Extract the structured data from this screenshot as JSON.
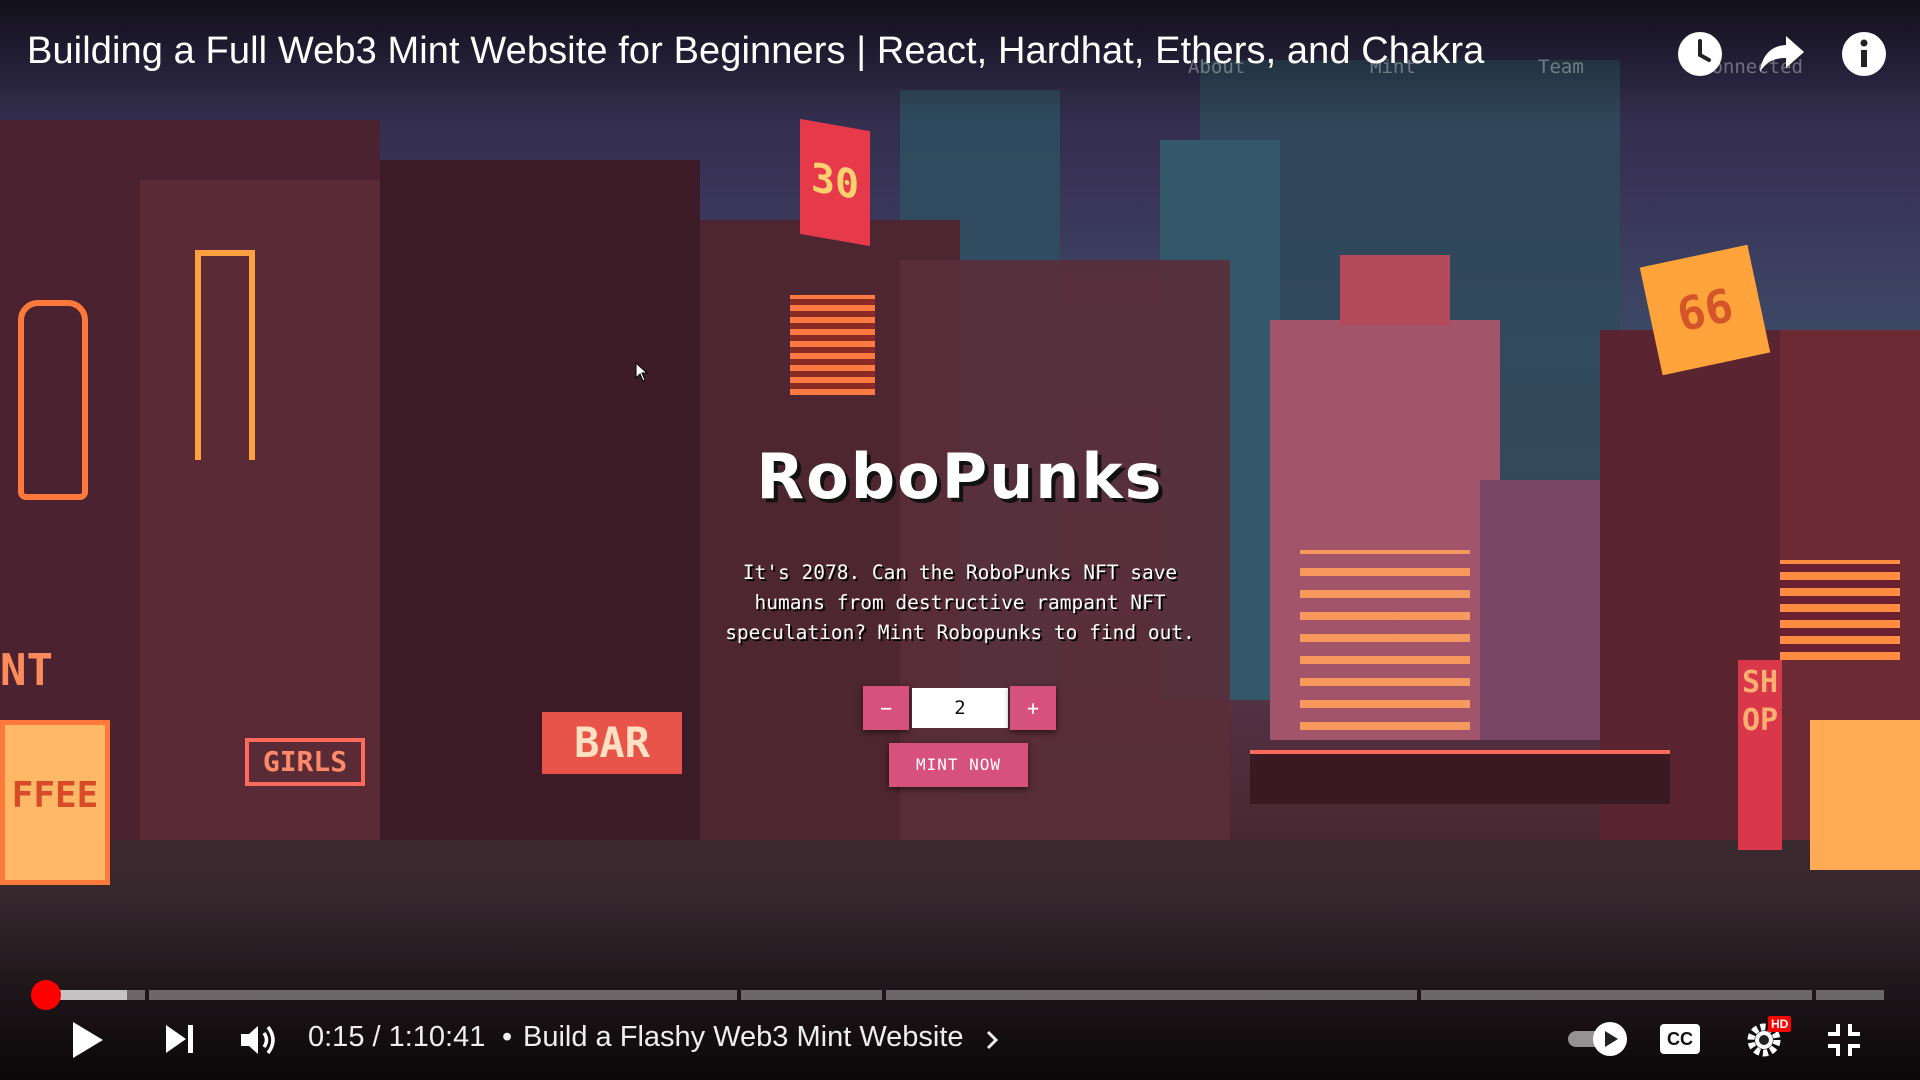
{
  "video": {
    "title": "Building a Full Web3 Mint Website for Beginners | React, Hardhat, Ethers, and Chakra"
  },
  "site": {
    "nav": [
      "About",
      "Mint",
      "Team",
      "Connected"
    ],
    "title": "RoboPunks",
    "description": "It's 2078. Can the RoboPunks NFT save humans from destructive rampant NFT speculation? Mint Robopunks to find out.",
    "quantity": "2",
    "decrement_label": "−",
    "increment_label": "+",
    "mint_label": "MINT NOW",
    "accent_color": "#d6517d"
  },
  "player": {
    "time": "0:15 / 1:10:41",
    "separator": "•",
    "chapter": "Build a Flashy Web3 Mint Website",
    "progress_fraction": 0.0035,
    "buffered_fraction": 0.047,
    "quality_badge": "HD",
    "cc_label": "CC",
    "icons": [
      "play-icon",
      "next-icon",
      "volume-icon",
      "autoplay-toggle-icon",
      "captions-icon",
      "settings-icon",
      "exit-fullscreen-icon",
      "watch-later-icon",
      "share-icon",
      "info-icon"
    ],
    "colors": {
      "progress": "#ff0000",
      "text": "#eeeeee"
    }
  },
  "signs": {
    "coffee": "FFEE",
    "bar": "BAR",
    "girls": "GIRLS",
    "shop": "SHOP",
    "thirty": "30",
    "sixty_six": "66",
    "nt": "NT"
  }
}
